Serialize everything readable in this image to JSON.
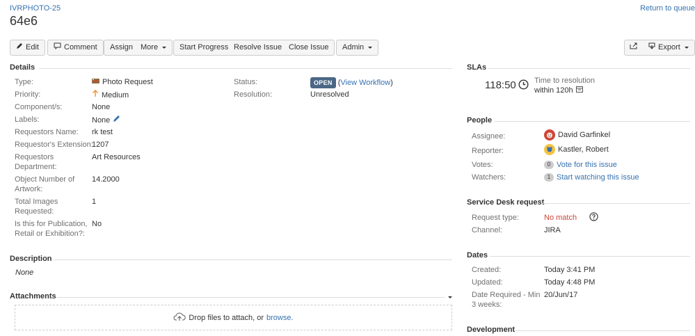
{
  "header": {
    "issue_key": "IVRPHOTO-25",
    "title": "64e6",
    "return_link": "Return to queue"
  },
  "toolbar": {
    "edit": "Edit",
    "comment": "Comment",
    "assign": "Assign",
    "more": "More",
    "start_progress": "Start Progress",
    "resolve_issue": "Resolve Issue",
    "close_issue": "Close Issue",
    "admin": "Admin",
    "export": "Export"
  },
  "details": {
    "heading": "Details",
    "type_label": "Type:",
    "type_value": "Photo Request",
    "priority_label": "Priority:",
    "priority_value": "Medium",
    "components_label": "Component/s:",
    "components_value": "None",
    "labels_label": "Labels:",
    "labels_value": "None",
    "req_name_label": "Requestors Name:",
    "req_name_value": "rk test",
    "req_ext_label": "Requestor's Extension:",
    "req_ext_value": "1207",
    "req_dept_label_1": "Requestors",
    "req_dept_label_2": "Department:",
    "req_dept_value": "Art Resources",
    "obj_num_label_1": "Object Number of",
    "obj_num_label_2": "Artwork:",
    "obj_num_value": "14.2000",
    "total_images_label_1": "Total Images",
    "total_images_label_2": "Requested:",
    "total_images_value": "1",
    "publication_label_1": "Is this for Publication,",
    "publication_label_2": "Retail or Exhibition?:",
    "publication_value": "No",
    "status_label": "Status:",
    "status_value": "OPEN",
    "view_workflow_open": "(",
    "view_workflow": "View Workflow",
    "view_workflow_close": ")",
    "resolution_label": "Resolution:",
    "resolution_value": "Unresolved"
  },
  "description": {
    "heading": "Description",
    "value": "None"
  },
  "attachments": {
    "heading": "Attachments",
    "drop_text": "Drop files to attach, or",
    "browse": "browse."
  },
  "slas": {
    "heading": "SLAs",
    "time": "118:50",
    "title": "Time to resolution",
    "within": "within 120h"
  },
  "people": {
    "heading": "People",
    "assignee_label": "Assignee:",
    "assignee_value": "David Garfinkel",
    "reporter_label": "Reporter:",
    "reporter_value": "Kastler, Robert",
    "votes_label": "Votes:",
    "votes_count": "0",
    "votes_link": "Vote for this issue",
    "watchers_label": "Watchers:",
    "watchers_count": "1",
    "watchers_link": "Start watching this issue"
  },
  "service_desk": {
    "heading": "Service Desk request",
    "request_type_label": "Request type:",
    "request_type_value": "No match",
    "channel_label": "Channel:",
    "channel_value": "JIRA"
  },
  "dates": {
    "heading": "Dates",
    "created_label": "Created:",
    "created_value": "Today 3:41 PM",
    "updated_label": "Updated:",
    "updated_value": "Today 4:48 PM",
    "date_required_label_1": "Date Required - Min",
    "date_required_label_2": "3 weeks:",
    "date_required_value": "20/Jun/17"
  },
  "development": {
    "heading": "Development"
  },
  "colors": {
    "link": "#3572b0",
    "status_open": "#4a6785",
    "no_match": "#d04437",
    "priority_medium": "#f79232"
  }
}
